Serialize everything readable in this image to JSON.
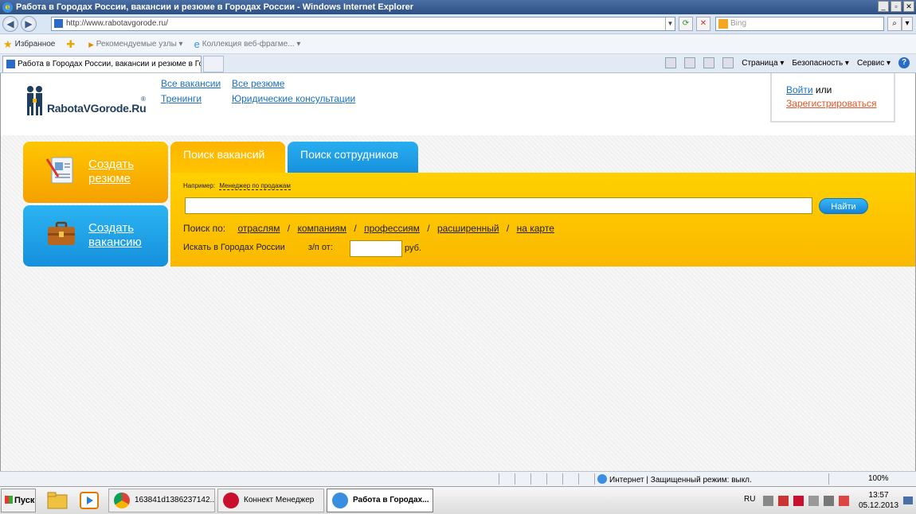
{
  "window": {
    "title": "Работа в Городах России, вакансии и резюме в Городах России - Windows Internet Explorer",
    "buttons": [
      "_",
      "▫",
      "✕"
    ]
  },
  "address": {
    "url": "http://www.rabotavgorode.ru/",
    "search_placeholder": "Bing"
  },
  "favorites": {
    "label": "Избранное",
    "suggested": "Рекомендуемые узлы ▾",
    "gallery": "Коллекция веб-фрагме... ▾"
  },
  "tab": {
    "title": "Работа в Городах России, вакансии и резюме в Го..."
  },
  "commandbar": {
    "page": "Страница ▾",
    "safety": "Безопасность ▾",
    "service": "Сервис ▾",
    "help": "?"
  },
  "site": {
    "logo_text": "RabotaVGorode.Ru",
    "logo_reg": "®",
    "links": {
      "all_vacancies": "Все вакансии",
      "all_resumes": "Все резюме",
      "trainings": "Тренинги",
      "legal": "Юридические консультации"
    },
    "login": {
      "login_link": "Войти",
      "or": " или",
      "register": "Зарегистрироваться"
    },
    "buttons": {
      "create_resume_1": "Создать",
      "create_resume_2": "резюме",
      "create_vacancy_1": "Создать",
      "create_vacancy_2": "вакансию"
    },
    "search": {
      "tab_vacancies": "Поиск вакансий",
      "tab_employees": "Поиск сотрудников",
      "example_label": "Например:",
      "example_value": "Менеджер по продажам",
      "find_button": "Найти",
      "search_by_label": "Поиск по:",
      "by_links": [
        "отраслям",
        "компаниям",
        "профессиям",
        "расширенный",
        "на карте"
      ],
      "city_label": "Искать в Городах России",
      "salary_label": "з/п от:",
      "currency": "руб."
    }
  },
  "status": {
    "zone": "Интернет | Защищенный режим: выкл.",
    "zoom": "100%"
  },
  "taskbar": {
    "start": "Пуск",
    "items": [
      "163841d1386237142...",
      "Коннект Менеджер",
      "Работа в Городах..."
    ],
    "lang": "RU",
    "time": "13:57",
    "date": "05.12.2013"
  },
  "colors": {
    "orange": "#ffc000",
    "blue": "#1f9fe8",
    "link": "#1a6fc2",
    "register": "#e0562a"
  }
}
